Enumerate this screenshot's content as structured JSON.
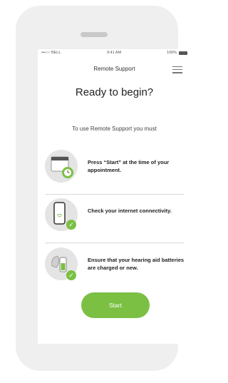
{
  "status_bar": {
    "carrier": "•••○○ BELL",
    "time": "9:41 AM",
    "battery_text": "100%"
  },
  "header": {
    "title": "Remote Support",
    "menu_icon": "hamburger-menu-icon"
  },
  "main": {
    "headline": "Ready to begin?",
    "intro": "To use Remote Support you must",
    "steps": [
      {
        "icon": "calendar-alarm-icon",
        "text": "Press “Start” at the time of your appointment."
      },
      {
        "icon": "phone-wifi-icon",
        "text": "Check your internet connectivity."
      },
      {
        "icon": "hearing-aid-battery-icon",
        "text": "Ensure that your hearing aid batteries are charged or new."
      }
    ],
    "start_label": "Start"
  },
  "colors": {
    "accent": "#7bc043",
    "bezel": "#efefef"
  }
}
